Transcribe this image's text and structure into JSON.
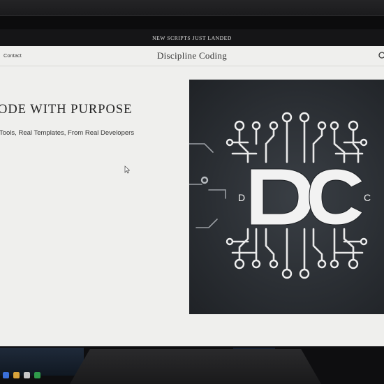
{
  "announcement": "NEW SCRIPTS JUST LANDED",
  "nav": {
    "items": [
      "Contact"
    ],
    "site_title": "Discipline Coding",
    "search_icon": "search-icon"
  },
  "hero": {
    "heading": "ODE WITH PURPOSE",
    "subheading": "Tools, Real Templates, From Real Developers"
  },
  "logo": {
    "letters": "DC",
    "small_left": "D",
    "small_right": "C"
  },
  "colors": {
    "page_bg": "#efefed",
    "banner_bg": "#151517",
    "logo_bg": "#2b2f34",
    "logo_fg": "#f2f2f2"
  }
}
